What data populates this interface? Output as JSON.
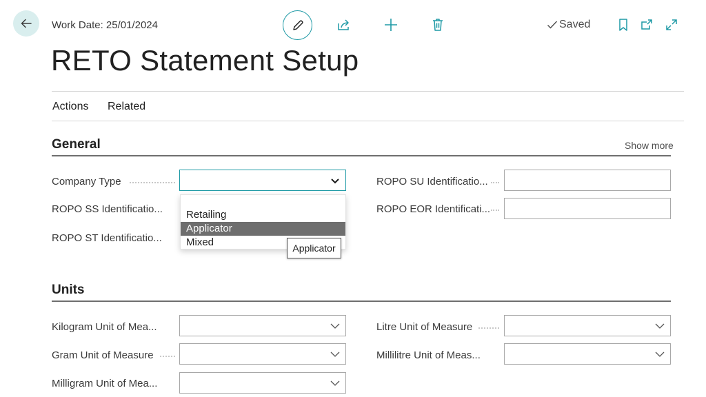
{
  "header": {
    "work_date": "Work Date: 25/01/2024",
    "saved_label": "Saved",
    "icons": {
      "back": "back-arrow-icon",
      "edit": "pencil-icon",
      "share": "share-icon",
      "new": "plus-icon",
      "delete": "trash-icon",
      "saved": "checkmark-icon",
      "bookmark": "bookmark-icon",
      "popout": "open-in-new-window-icon",
      "expand": "expand-icon"
    }
  },
  "page_title": "RETO Statement Setup",
  "menu": {
    "actions": "Actions",
    "related": "Related"
  },
  "general": {
    "title": "General",
    "show_more": "Show more",
    "company_type_label": "Company Type",
    "company_type_value": "",
    "ropo_ss_label": "ROPO SS Identificatio...",
    "ropo_st_label": "ROPO ST Identificatio...",
    "ropo_su_label": "ROPO SU Identificatio...",
    "ropo_su_value": "",
    "ropo_eor_label": "ROPO EOR Identificati...",
    "ropo_eor_value": ""
  },
  "dropdown": {
    "options": [
      "",
      "Retailing",
      "Applicator",
      "Mixed"
    ],
    "highlighted": "Applicator",
    "tooltip": "Applicator"
  },
  "units": {
    "title": "Units",
    "kilogram_label": "Kilogram Unit of Mea...",
    "kilogram_value": "",
    "gram_label": "Gram Unit of Measure",
    "gram_value": "",
    "milligram_label": "Milligram Unit of Mea...",
    "milligram_value": "",
    "litre_label": "Litre Unit of Measure",
    "litre_value": "",
    "millilitre_label": "Millilitre Unit of Meas...",
    "millilitre_value": ""
  },
  "colors": {
    "accent": "#1f9aa6",
    "back_button_bg": "#d9eeee",
    "selected_option_bg": "#6e6e6e"
  }
}
